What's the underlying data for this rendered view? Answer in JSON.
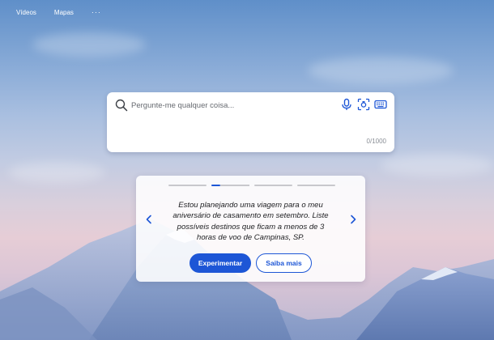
{
  "nav": {
    "links": [
      "Vídeos",
      "Mapas"
    ],
    "more": "···"
  },
  "search": {
    "placeholder": "Pergunte-me qualquer coisa...",
    "value": "",
    "counter": "0/1000",
    "icons": [
      "search-icon",
      "microphone-icon",
      "visual-search-icon",
      "keyboard-icon"
    ]
  },
  "card": {
    "slide_index": 2,
    "slide_count": 4,
    "prompt": "Estou planejando uma viagem para o meu aniversário de casamento em setembro. Liste possíveis destinos que ficam a menos de 3 horas de voo de Campinas, SP.",
    "primary_button": "Experimentar",
    "secondary_button": "Saiba mais"
  },
  "colors": {
    "accent": "#1d56d6",
    "card_bg": "#ffffff",
    "text": "#202124"
  }
}
